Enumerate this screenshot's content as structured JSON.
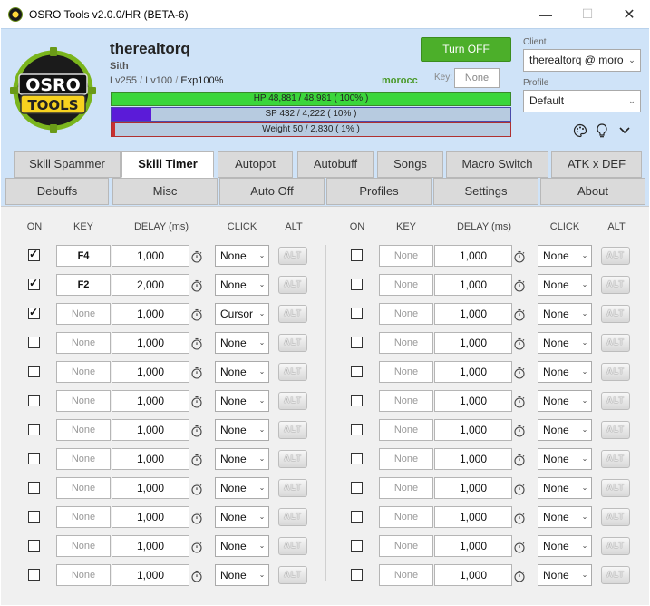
{
  "window": {
    "title": "OSRO Tools v2.0.0/HR (BETA-6)"
  },
  "character": {
    "name": "therealtorq",
    "class": "Sith",
    "base_level": "Lv255",
    "job_level": "Lv100",
    "exp": "Exp100%",
    "map": "morocc"
  },
  "header": {
    "turn_off_label": "Turn OFF",
    "key_label": "Key:",
    "key_value": "None",
    "client_label": "Client",
    "client_value": "therealtorq @ morocc",
    "profile_label": "Profile",
    "profile_value": "Default"
  },
  "bars": {
    "hp": {
      "text": "HP  48,881  /  48,981  ( 100% )",
      "percent": 100
    },
    "sp": {
      "text": "SP  432  /  4,222  ( 10% )",
      "percent": 10
    },
    "weight": {
      "text": "Weight  50  /  2,830  ( 1% )",
      "percent": 1
    }
  },
  "tabs_row1": [
    "Skill Spammer",
    "Skill Timer",
    "Autopot",
    "Autobuff",
    "Songs",
    "Macro Switch",
    "ATK x DEF"
  ],
  "tabs_row2": [
    "Debuffs",
    "Misc",
    "Auto Off",
    "Profiles",
    "Settings",
    "About"
  ],
  "active_tab": "Skill Timer",
  "columns": {
    "on": "ON",
    "key": "KEY",
    "delay": "DELAY (ms)",
    "click": "CLICK",
    "alt": "ALT"
  },
  "alt_label": "ALT",
  "left_rows": [
    {
      "on": true,
      "key": "F4",
      "key_set": true,
      "delay": "1,000",
      "click": "None"
    },
    {
      "on": true,
      "key": "F2",
      "key_set": true,
      "delay": "2,000",
      "click": "None"
    },
    {
      "on": true,
      "key": "None",
      "key_set": false,
      "delay": "1,000",
      "click": "Cursor"
    },
    {
      "on": false,
      "key": "None",
      "key_set": false,
      "delay": "1,000",
      "click": "None"
    },
    {
      "on": false,
      "key": "None",
      "key_set": false,
      "delay": "1,000",
      "click": "None"
    },
    {
      "on": false,
      "key": "None",
      "key_set": false,
      "delay": "1,000",
      "click": "None"
    },
    {
      "on": false,
      "key": "None",
      "key_set": false,
      "delay": "1,000",
      "click": "None"
    },
    {
      "on": false,
      "key": "None",
      "key_set": false,
      "delay": "1,000",
      "click": "None"
    },
    {
      "on": false,
      "key": "None",
      "key_set": false,
      "delay": "1,000",
      "click": "None"
    },
    {
      "on": false,
      "key": "None",
      "key_set": false,
      "delay": "1,000",
      "click": "None"
    },
    {
      "on": false,
      "key": "None",
      "key_set": false,
      "delay": "1,000",
      "click": "None"
    },
    {
      "on": false,
      "key": "None",
      "key_set": false,
      "delay": "1,000",
      "click": "None"
    }
  ],
  "right_rows": [
    {
      "on": false,
      "key": "None",
      "key_set": false,
      "delay": "1,000",
      "click": "None"
    },
    {
      "on": false,
      "key": "None",
      "key_set": false,
      "delay": "1,000",
      "click": "None"
    },
    {
      "on": false,
      "key": "None",
      "key_set": false,
      "delay": "1,000",
      "click": "None"
    },
    {
      "on": false,
      "key": "None",
      "key_set": false,
      "delay": "1,000",
      "click": "None"
    },
    {
      "on": false,
      "key": "None",
      "key_set": false,
      "delay": "1,000",
      "click": "None"
    },
    {
      "on": false,
      "key": "None",
      "key_set": false,
      "delay": "1,000",
      "click": "None"
    },
    {
      "on": false,
      "key": "None",
      "key_set": false,
      "delay": "1,000",
      "click": "None"
    },
    {
      "on": false,
      "key": "None",
      "key_set": false,
      "delay": "1,000",
      "click": "None"
    },
    {
      "on": false,
      "key": "None",
      "key_set": false,
      "delay": "1,000",
      "click": "None"
    },
    {
      "on": false,
      "key": "None",
      "key_set": false,
      "delay": "1,000",
      "click": "None"
    },
    {
      "on": false,
      "key": "None",
      "key_set": false,
      "delay": "1,000",
      "click": "None"
    },
    {
      "on": false,
      "key": "None",
      "key_set": false,
      "delay": "1,000",
      "click": "None"
    }
  ],
  "icons": {
    "palette": "palette-icon",
    "bulb": "lightbulb-icon",
    "chevron": "chevron-down-icon",
    "timer": "stopwatch-icon"
  },
  "colors": {
    "accent_green": "#4caf2a",
    "hp": "#3bd63b",
    "sp": "#5b1bd8",
    "weight": "#c93030",
    "header_bg": "#cfe3f8"
  }
}
